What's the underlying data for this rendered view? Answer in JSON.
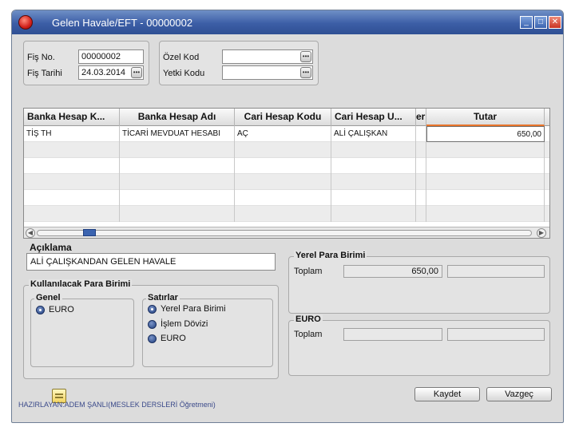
{
  "window": {
    "title": "Gelen Havale/EFT - 00000002"
  },
  "header": {
    "fis_no_label": "Fiş No.",
    "fis_no_value": "00000002",
    "fis_tarihi_label": "Fiş Tarihi",
    "fis_tarihi_value": "24.03.2014",
    "ozel_kod_label": "Özel Kod",
    "ozel_kod_value": "",
    "yetki_kodu_label": "Yetki Kodu",
    "yetki_kodu_value": ""
  },
  "grid": {
    "columns": [
      "Banka Hesap K...",
      "Banka Hesap Adı",
      "Cari Hesap Kodu",
      "Cari Hesap U...",
      "er",
      "Tutar"
    ],
    "rows": [
      [
        "TİŞ   TH",
        "TİCARİ MEVDUAT HESABI",
        "AÇ",
        "ALİ ÇALIŞKAN",
        "",
        "650,00"
      ]
    ]
  },
  "aciklama": {
    "label": "Açıklama",
    "value": "ALİ ÇALIŞKANDAN GELEN HAVALE"
  },
  "para_birimi": {
    "title": "Kullanılacak Para Birimi",
    "genel_title": "Genel",
    "genel_option": "EURO",
    "satirlar_title": "Satırlar",
    "satirlar_options": [
      "Yerel Para Birimi",
      "İşlem Dövizi",
      "EURO"
    ]
  },
  "yerel": {
    "title": "Yerel Para Birimi",
    "toplam_label": "Toplam",
    "toplam_value": "650,00"
  },
  "euro": {
    "title": "EURO",
    "toplam_label": "Toplam",
    "toplam_value": ""
  },
  "buttons": {
    "save": "Kaydet",
    "cancel": "Vazgeç"
  },
  "footer": {
    "note": "HAZIRLAYAN:ADEM ŞANLI(MESLEK DERSLERİ Öğretmeni)"
  },
  "colors": {
    "titlebar": "#3c5ea6",
    "accent_underline": "#e8742a",
    "radio": "#1f3f80"
  }
}
